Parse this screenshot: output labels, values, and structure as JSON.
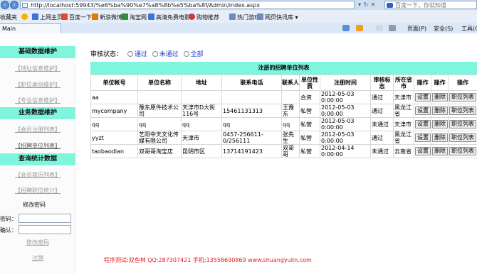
{
  "browser": {
    "url": "http://localhost:59943/%e6%ba%90%e7%a8%8b%e5%ba%8f/Admin/index.aspx",
    "search_placeholder": "百度一下，你就知道",
    "tab_label": "Main",
    "favorites_label": "收藏夹",
    "favorites": [
      "上网主页",
      "百度一下",
      "新浪微博",
      "淘宝网",
      "高清免费电影",
      "购物推荐",
      "热门游戏",
      "网页快讯库"
    ],
    "commands": {
      "page": "页面(P)",
      "safety": "安全(S)",
      "tools": "工具(O)"
    },
    "icon_colors": [
      "#f0b400",
      "#3b73d8",
      "#e24a2b",
      "#e07b00",
      "#2b8f3e",
      "#3b73d8",
      "#c83a3a",
      "#6a8cc0"
    ]
  },
  "sidebar": {
    "sections": [
      {
        "title": "基础数据维护",
        "links": [
          "【地址信息维护】",
          "【职位类别维护】",
          "【专业信息维护】"
        ]
      },
      {
        "title": "业务数据维护",
        "links": [
          "【会员注册列表】",
          "【招聘单位列表】"
        ]
      },
      {
        "title": "查询统计数据",
        "links": [
          "【会员简历列表】",
          "【招聘职位统计】"
        ]
      }
    ],
    "password": {
      "title": "修改密码",
      "old_label": "密码：",
      "confirm_label": "确认：",
      "submit": "修改密码",
      "logout": "注销"
    }
  },
  "filter": {
    "label": "审核状态：",
    "options": [
      "通过",
      "未通过",
      "全部"
    ]
  },
  "grid": {
    "title": "注册的招聘单位列表",
    "columns": [
      "单位帐号",
      "单位名称",
      "地址",
      "联系电话",
      "联系人",
      "单位性质",
      "注册时间",
      "审核标志",
      "所在省市",
      "操作",
      "操作",
      "操作"
    ],
    "rows": [
      [
        "aa",
        "",
        "",
        "",
        "",
        "合资",
        "2012-05-03 0:00:00",
        "通过",
        "天津市",
        "设置",
        "删除",
        "职位列表"
      ],
      [
        "mycompany",
        "豫东原件技术公司",
        "天津市D大街116号",
        "15461131313",
        "王豫东",
        "私营",
        "2012-05-03 0:00:00",
        "通过",
        "黑龙江省",
        "设置",
        "删除",
        "职位列表"
      ],
      [
        "qq",
        "qq",
        "qq",
        "qq",
        "qq",
        "私营",
        "2012-05-03 0:00:00",
        "未通过",
        "天津市",
        "设置",
        "删除",
        "职位列表"
      ],
      [
        "yyzt",
        "艺阳中天文化传媒有限公司",
        "天津市",
        "0457-256611-0/256111",
        "张先生",
        "私营",
        "2012-05-03 0:00:00",
        "通过",
        "黑龙江省",
        "设置",
        "删除",
        "职位列表"
      ],
      [
        "taobaodian",
        "双哥哥淘宝店",
        "昆明市区",
        "13714191423",
        "双哥哥",
        "私营",
        "2012-04-14 0:00:00",
        "未通过",
        "云南省",
        "设置",
        "删除",
        "职位列表"
      ]
    ]
  },
  "footer": "程序测试:双鱼林 QQ:287307421 手机:13558690869 www.shuangyulin.com"
}
